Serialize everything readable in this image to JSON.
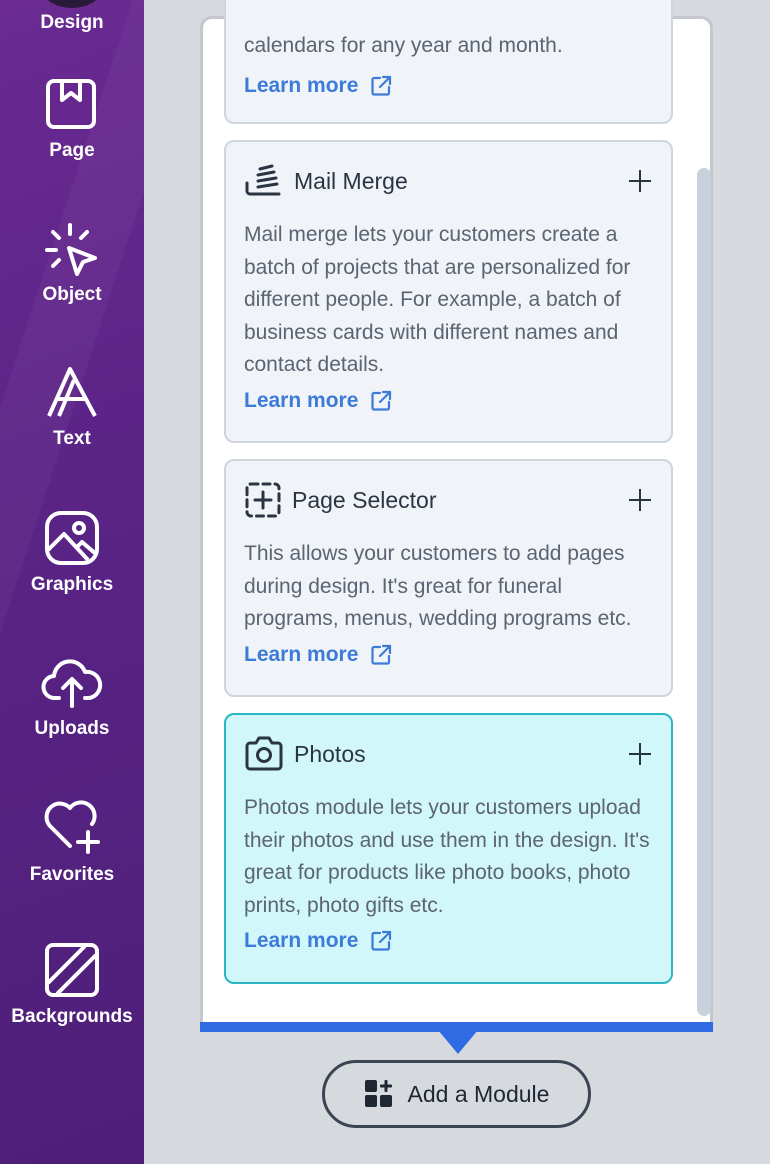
{
  "sidebar": {
    "items": [
      {
        "label": "Design",
        "icon": "design-icon"
      },
      {
        "label": "Page",
        "icon": "page-icon"
      },
      {
        "label": "Object",
        "icon": "object-icon"
      },
      {
        "label": "Text",
        "icon": "text-icon"
      },
      {
        "label": "Graphics",
        "icon": "graphics-icon"
      },
      {
        "label": "Uploads",
        "icon": "uploads-icon"
      },
      {
        "label": "Favorites",
        "icon": "favorites-icon"
      },
      {
        "label": "Backgrounds",
        "icon": "backgrounds-icon"
      }
    ]
  },
  "modules": [
    {
      "title": "",
      "icon": "calendar-icon",
      "description": "calendars for any year and month.",
      "learn_more": "Learn more"
    },
    {
      "title": "Mail Merge",
      "icon": "mail-merge-icon",
      "description": "Mail merge lets your customers create a batch of projects that are personalized for different people. For example, a batch of business cards with different names and contact details.",
      "learn_more": "Learn more"
    },
    {
      "title": "Page Selector",
      "icon": "page-selector-icon",
      "description": "This allows your customers to add pages during design. It's great for funeral programs, menus, wedding programs etc.",
      "learn_more": "Learn more"
    },
    {
      "title": "Photos",
      "icon": "camera-icon",
      "description": "Photos module lets your customers upload their photos and use them in the design. It's great for products like photo books, photo prints, photo gifts etc.",
      "learn_more": "Learn more",
      "active": true
    }
  ],
  "add_module": {
    "label": "Add a Module",
    "icon": "add-module-icon"
  },
  "colors": {
    "sidebar": "#5b2487",
    "accent": "#2f6be3",
    "link": "#3c7bd8",
    "active_card": "#d2f7fb",
    "active_border": "#2ab7c4"
  }
}
